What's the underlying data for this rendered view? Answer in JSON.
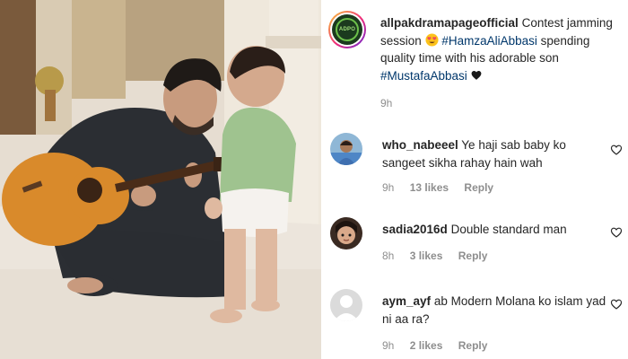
{
  "caption": {
    "username": "allpakdramapageofficial",
    "text_part1": "Contest jamming session",
    "hashtag1": "#HamzaAliAbbasi",
    "text_part2": "spending quality time with his adorable son",
    "hashtag2": "#MustafaAbbasi",
    "time": "9h",
    "avatar_logo_text": "ADPO"
  },
  "comments": [
    {
      "username": "who_nabeeel",
      "text": "Ye haji sab baby ko sangeet sikha rahay hain wah",
      "time": "9h",
      "likes": "13 likes",
      "reply": "Reply"
    },
    {
      "username": "sadia2016d",
      "text": "Double standard man",
      "time": "8h",
      "likes": "3 likes",
      "reply": "Reply"
    },
    {
      "username": "aym_ayf",
      "text": "ab Modern Molana ko islam yad ni aa ra?",
      "time": "9h",
      "likes": "2 likes",
      "reply": "Reply"
    }
  ],
  "colors": {
    "hashtag": "#00376b",
    "meta": "#8e8e8e",
    "text": "#262626"
  }
}
